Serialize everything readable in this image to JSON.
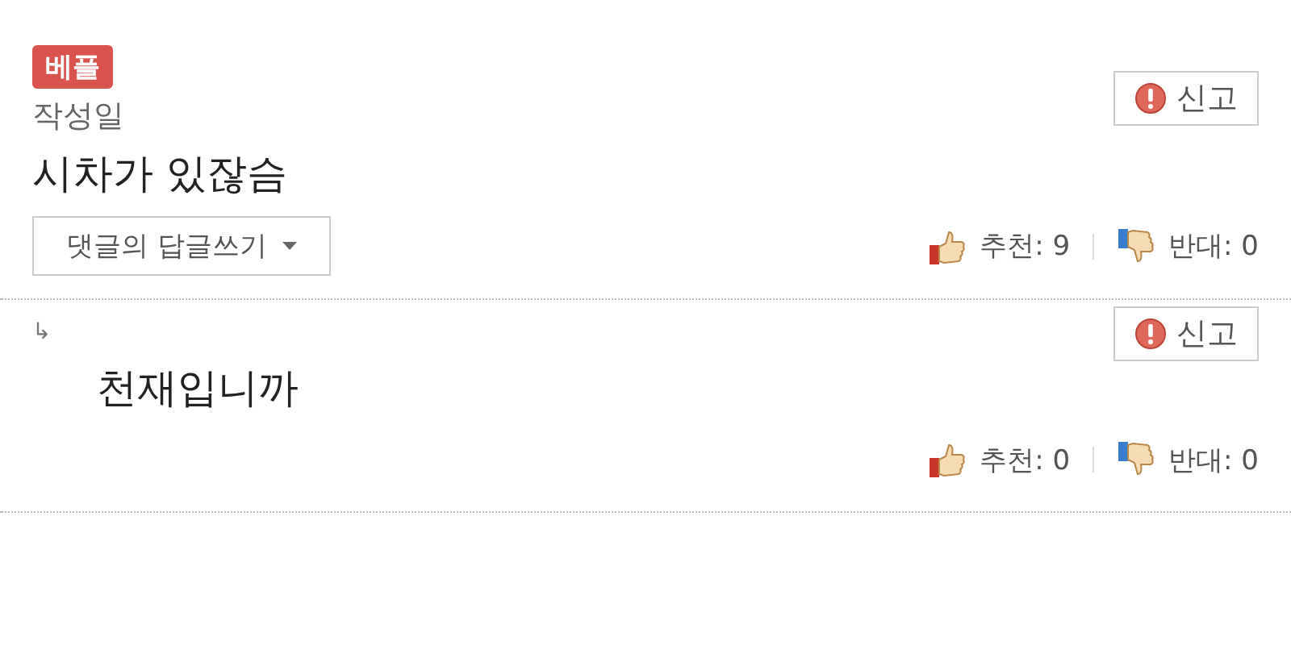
{
  "comments": [
    {
      "badge": "베플",
      "label": "작성일",
      "report": "신고",
      "text": "시차가 있잖슴",
      "reply_button": "댓글의 답글쓰기",
      "up": "추천: 9",
      "down": "반대: 0"
    },
    {
      "reply_mark": "↳",
      "report": "신고",
      "text": "천재입니까",
      "up": "추천: 0",
      "down": "반대: 0"
    }
  ]
}
